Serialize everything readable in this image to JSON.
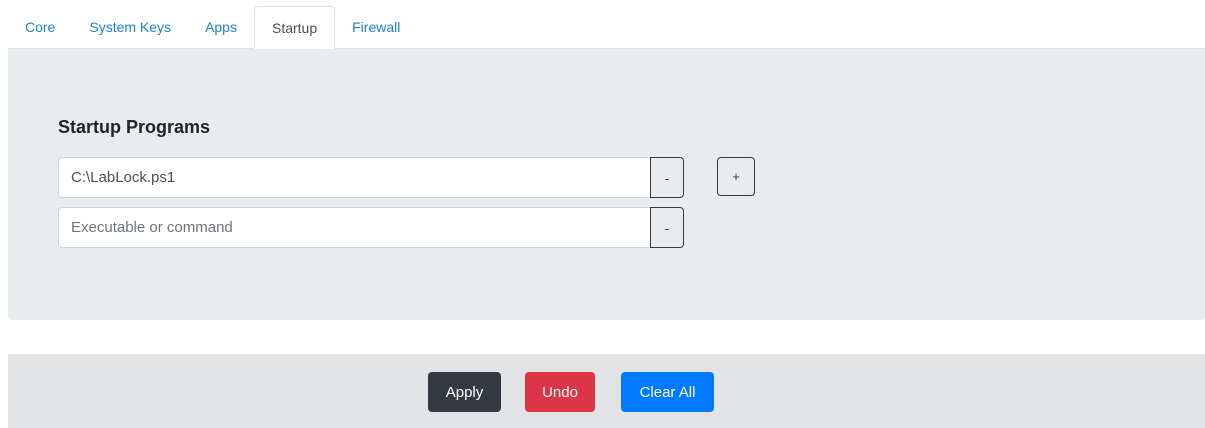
{
  "tabs": [
    {
      "label": "Core",
      "active": false
    },
    {
      "label": "System Keys",
      "active": false
    },
    {
      "label": "Apps",
      "active": false
    },
    {
      "label": "Startup",
      "active": true
    },
    {
      "label": "Firewall",
      "active": false
    }
  ],
  "startup": {
    "title": "Startup Programs",
    "rows": [
      {
        "value": "C:\\LabLock.ps1",
        "placeholder": "Executable or command",
        "remove_label": "-"
      },
      {
        "value": "",
        "placeholder": "Executable or command",
        "remove_label": "-"
      }
    ],
    "add_label": "+"
  },
  "footer": {
    "apply_label": "Apply",
    "undo_label": "Undo",
    "clear_label": "Clear All"
  },
  "colors": {
    "link": "#1a82e2",
    "panel_bg": "#e9ecef",
    "footer_bg": "#e2e3e5",
    "apply": "#343a40",
    "undo": "#dc3545",
    "clear": "#007bff"
  }
}
